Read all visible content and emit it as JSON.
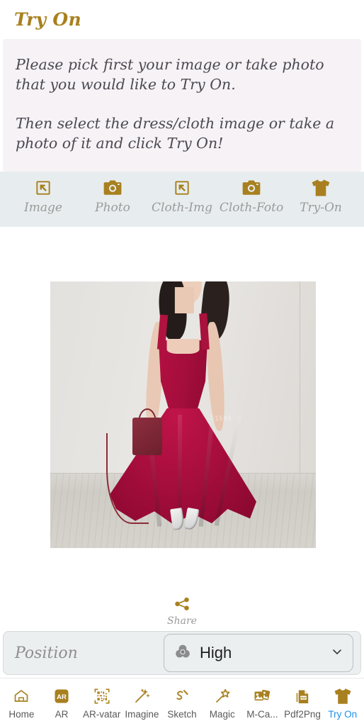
{
  "header": {
    "title": "Try On"
  },
  "instructions": {
    "line1": "Please pick first your image or take photo that you would like to Try On.",
    "line2": "Then select the dress/cloth image or take a photo of it and click Try On!"
  },
  "toolbar": {
    "items": [
      {
        "label": "Image",
        "icon": "image-import-icon"
      },
      {
        "label": "Photo",
        "icon": "camera-icon"
      },
      {
        "label": "Cloth-Img",
        "icon": "image-import-icon"
      },
      {
        "label": "Cloth-Foto",
        "icon": "camera-icon"
      },
      {
        "label": "Try-On",
        "icon": "tshirt-icon"
      }
    ]
  },
  "preview": {
    "alt": "Woman wearing a burgundy sleeveless maxi dress holding a small burgundy handbag",
    "watermark": "1599"
  },
  "share": {
    "label": "Share",
    "icon": "share-icon"
  },
  "position": {
    "label": "Position",
    "select": {
      "value": "High",
      "icon": "color-circles-icon",
      "chevron": "chevron-down-icon"
    }
  },
  "bottomnav": {
    "items": [
      {
        "label": "Home",
        "icon": "home-icon",
        "active": false
      },
      {
        "label": "AR",
        "icon": "ar-icon",
        "active": false
      },
      {
        "label": "AR-vatar",
        "icon": "qrcode-icon",
        "active": false
      },
      {
        "label": "Imagine",
        "icon": "wand-icon",
        "active": false
      },
      {
        "label": "Sketch",
        "icon": "sketch-icon",
        "active": false
      },
      {
        "label": "Magic",
        "icon": "magic-star-icon",
        "active": false
      },
      {
        "label": "M-Ca...",
        "icon": "photos-icon",
        "active": false
      },
      {
        "label": "Pdf2Png",
        "icon": "pdf-icon",
        "active": false
      },
      {
        "label": "Try On",
        "icon": "tshirt-icon",
        "active": true
      }
    ]
  },
  "colors": {
    "gold": "#a8801f",
    "panel_pink": "#f7f2f6",
    "toolbar_bg": "#e7edee",
    "active_blue": "#1e90e8",
    "dress": "#a80e3e"
  }
}
